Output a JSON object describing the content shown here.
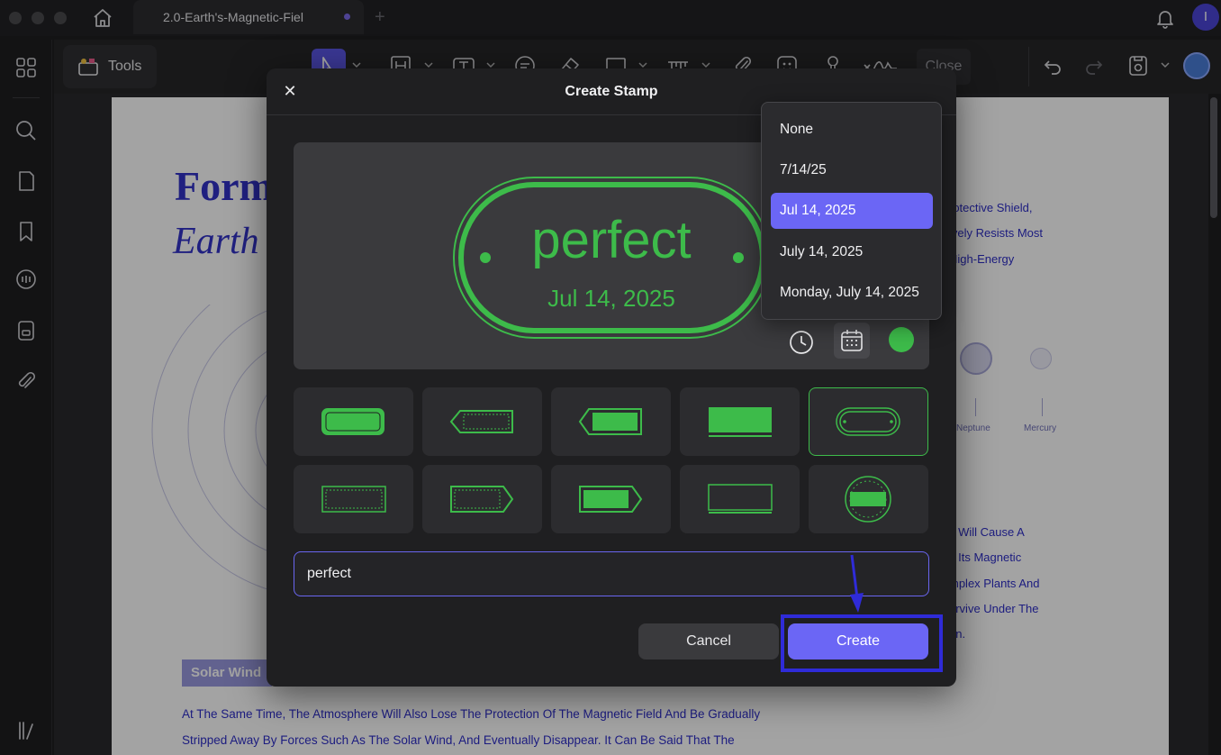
{
  "window": {
    "tab_title": "2.0-Earth's-Magnetic-Fiel",
    "avatar_initial": "I"
  },
  "toolbar": {
    "tools_label": "Tools",
    "close_label": "Close"
  },
  "document": {
    "heading_1": "Form",
    "heading_2": "Earth",
    "right_lines": [
      "rotective Shield,",
      "ively Resists Most",
      "High-Energy"
    ],
    "planet_labels": [
      "Neptune",
      "Mercury"
    ],
    "right_lines_2": [
      "y Will Cause A",
      "s Its Magnetic",
      "mplex Plants And",
      "urvive Under The",
      "on."
    ],
    "solar_wind_tag": "Solar Wind",
    "paragraph": [
      "At The Same Time, The Atmosphere Will Also Lose The Protection Of The Magnetic Field And Be Gradually",
      "Stripped Away By Forces Such As The Solar Wind, And Eventually Disappear. It Can Be Said That The"
    ]
  },
  "modal": {
    "title": "Create Stamp",
    "stamp_preview": {
      "text": "perfect",
      "date": "Jul 14, 2025",
      "color": "#3dbb4a"
    },
    "text_input_value": "perfect",
    "cancel_label": "Cancel",
    "create_label": "Create"
  },
  "date_dropdown": {
    "options": [
      "None",
      "7/14/25",
      "Jul 14, 2025",
      "July 14, 2025",
      "Monday, July 14, 2025"
    ],
    "selected": "Jul 14, 2025"
  },
  "colors": {
    "accent": "#6b66f5",
    "stamp_green": "#3dbb4a",
    "doc_text": "#2e2ec8"
  }
}
